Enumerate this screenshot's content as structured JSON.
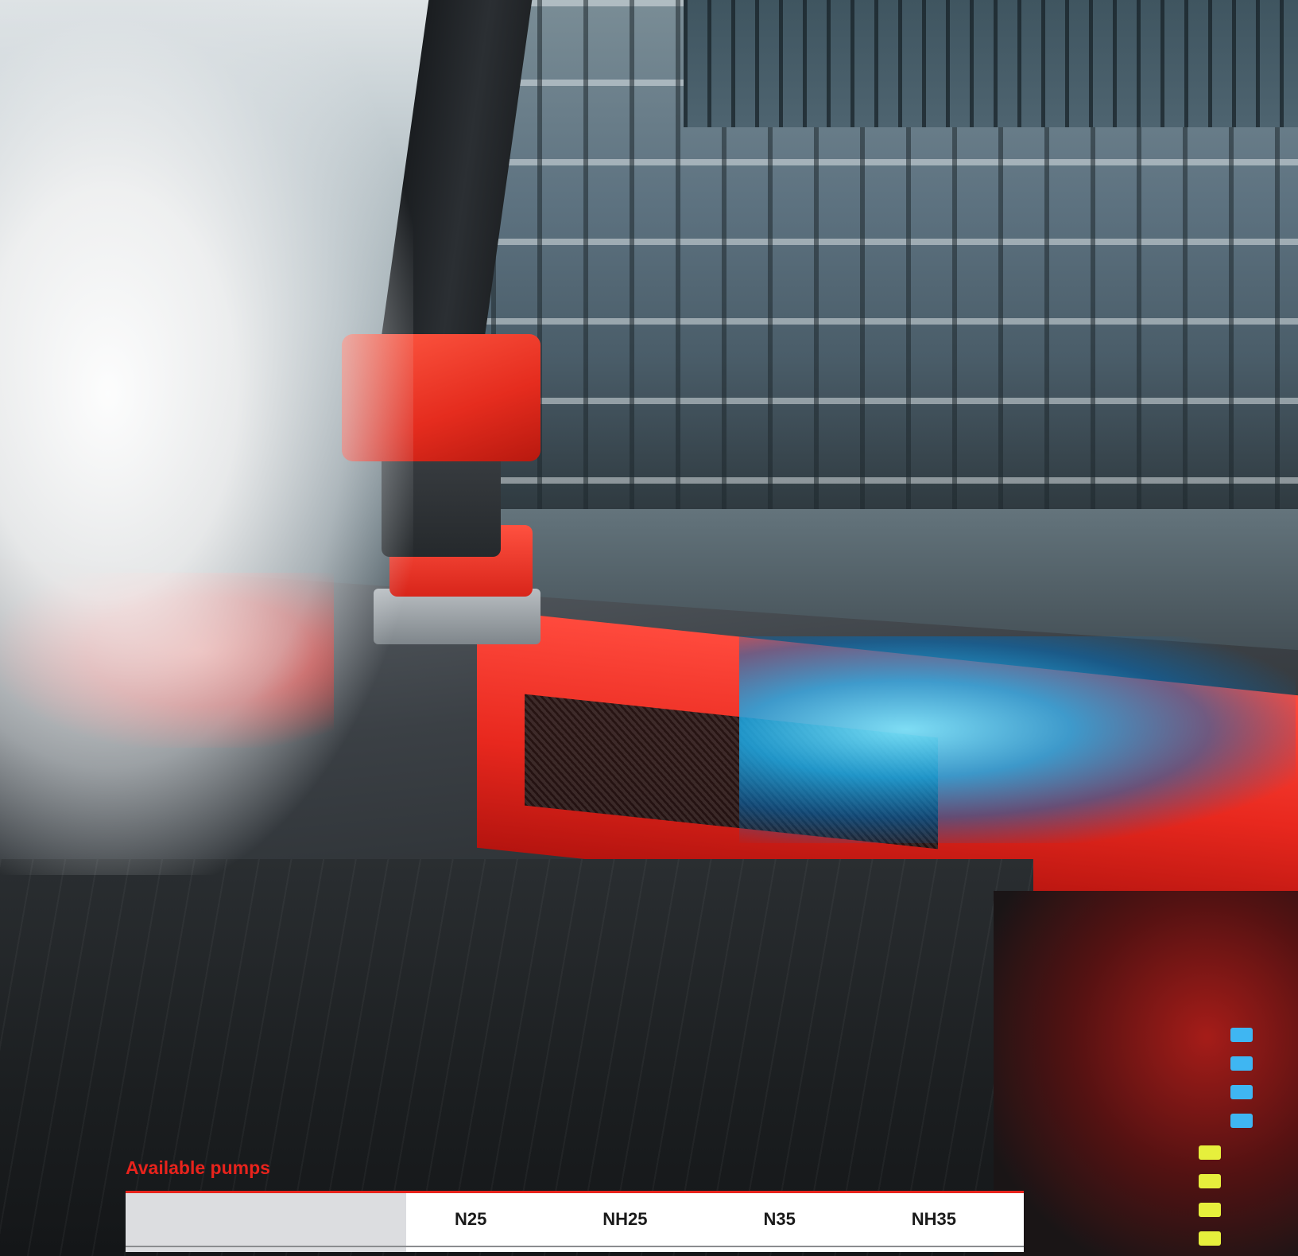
{
  "section": {
    "title": "Available pumps"
  },
  "table": {
    "corner_label": "",
    "columns": [
      "N25",
      "NH25",
      "N35",
      "NH35"
    ]
  },
  "colors": {
    "accent": "#e8231c",
    "corner_fill": "#dcdde0"
  },
  "image": {
    "description_icon": "fire-truck-roof-monitor-image"
  }
}
